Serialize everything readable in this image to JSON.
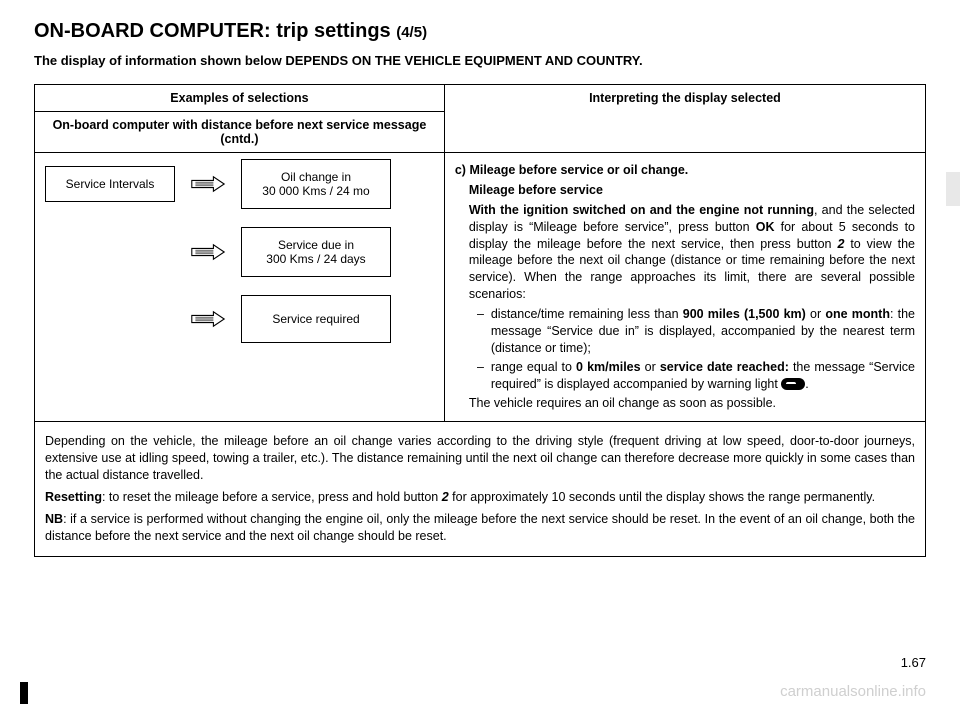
{
  "title_main": "ON-BOARD COMPUTER: trip settings ",
  "title_suffix": "(4/5)",
  "notice": "The display of information shown below DEPENDS ON THE VEHICLE EQUIPMENT AND COUNTRY.",
  "headers": {
    "left_top": "Examples of selections",
    "left_sub": "On-board computer with distance before next service message (cntd.)",
    "right": "Interpreting the display selected"
  },
  "diagram": {
    "service_intervals": "Service Intervals",
    "oil_change_line1": "Oil change in",
    "oil_change_line2": "30 000 Kms / 24 mo",
    "service_due_line1": "Service due in",
    "service_due_line2": "300 Kms / 24 days",
    "service_required": "Service required"
  },
  "interp": {
    "c_head": "c) Mileage before service or oil change.",
    "sub_head": "Mileage before service",
    "lead_bold": "With the ignition switched on and the engine not running",
    "lead_rest1": ", and the selected display is “Mileage before service”, press button ",
    "ok": "OK",
    "lead_rest2": " for about 5 seconds to display the mileage before the next service, then press button ",
    "btn2": "2",
    "lead_rest3": " to view the mileage before the next oil change (distance or time remaining before the next service). When the range approaches its limit, there are several possible scenarios:",
    "bullet1_a": "distance/time remaining less than ",
    "bullet1_b": "900 miles (1,500 km)",
    "bullet1_c": " or ",
    "bullet1_d": "one month",
    "bullet1_e": ": the message “Service due in” is displayed, accompanied by the nearest term (distance or time);",
    "bullet2_a": "range equal to ",
    "bullet2_b": "0 km/miles",
    "bullet2_c": " or ",
    "bullet2_d": "service date reached:",
    "bullet2_e": " the message “Service required” is displayed accompanied by warning light ",
    "bullet2_f": ".",
    "tail": "The vehicle requires an oil change as soon as possible."
  },
  "foot": {
    "p1": "Depending on the vehicle, the mileage before an oil change varies according to the driving style (frequent driving at low speed, door-to-door journeys, extensive use at idling speed, towing a trailer, etc.). The distance remaining until the next oil change can therefore decrease more quickly in some cases than the actual distance travelled.",
    "p2_a": "Resetting",
    "p2_b": ": to reset the mileage before a service, press and hold button ",
    "p2_c": "2",
    "p2_d": " for approximately 10 seconds until the display shows the range permanently.",
    "p3_a": "NB",
    "p3_b": ": if a service is performed without changing the engine oil, only the mileage before the next service should be reset. In the event of an oil change, both the distance before the next service and the next oil change should be reset."
  },
  "pagenum": "1.67",
  "watermark": "carmanualsonline.info"
}
